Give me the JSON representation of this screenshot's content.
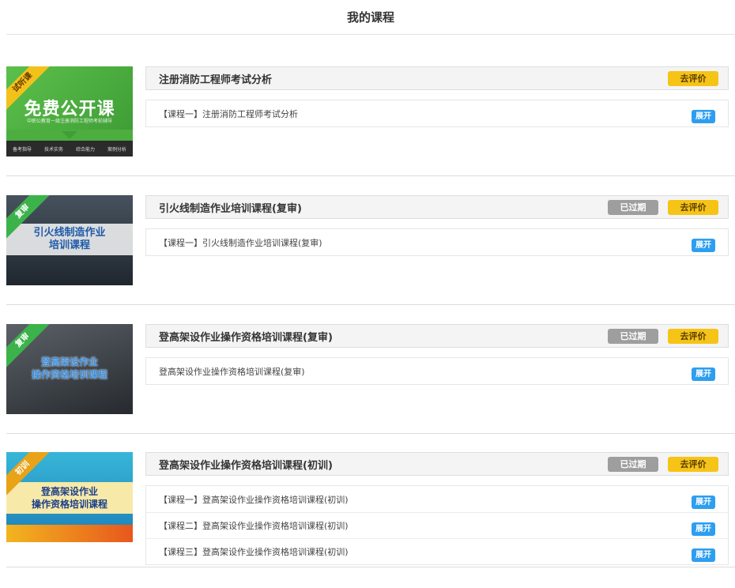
{
  "page": {
    "title": "我的课程"
  },
  "labels": {
    "review": "去评价",
    "expired": "已过期",
    "expand": "展开"
  },
  "courses": [
    {
      "name": "注册消防工程师考试分析",
      "expired": false,
      "thumb": {
        "ribbon": "试听课",
        "main": "免费公开课",
        "sub": "中职公教育一级注册消防工程师考前辅导",
        "tags": [
          "备考指导",
          "技术实务",
          "综合能力",
          "案例分析"
        ],
        "bg": "#4cae3f",
        "ribbon_color": "#f2c21b"
      },
      "lessons": [
        {
          "title": "【课程一】注册消防工程师考试分析"
        }
      ]
    },
    {
      "name": "引火线制造作业培训课程(复审)",
      "expired": true,
      "thumb": {
        "ribbon": "复审",
        "main": "引火线制造作业\n培训课程",
        "bg": "#2b3440",
        "ribbon_color": "#3bb34a"
      },
      "lessons": [
        {
          "title": "【课程一】引火线制造作业培训课程(复审)"
        }
      ]
    },
    {
      "name": "登高架设作业操作资格培训课程(复审)",
      "expired": true,
      "thumb": {
        "ribbon": "复审",
        "main": "登高架设作业\n操作资格培训课程",
        "bg": "#3a3f45",
        "ribbon_color": "#3bb34a"
      },
      "lessons": [
        {
          "title": "登高架设作业操作资格培训课程(复审)"
        }
      ]
    },
    {
      "name": "登高架设作业操作资格培训课程(初训)",
      "expired": true,
      "thumb": {
        "ribbon": "初训",
        "main": "登高架设作业\n操作资格培训课程",
        "bg": "#2aa6c9",
        "ribbon_color": "#e8a318"
      },
      "lessons": [
        {
          "title": "【课程一】登高架设作业操作资格培训课程(初训)"
        },
        {
          "title": "【课程二】登高架设作业操作资格培训课程(初训)"
        },
        {
          "title": "【课程三】登高架设作业操作资格培训课程(初训)"
        }
      ]
    }
  ]
}
